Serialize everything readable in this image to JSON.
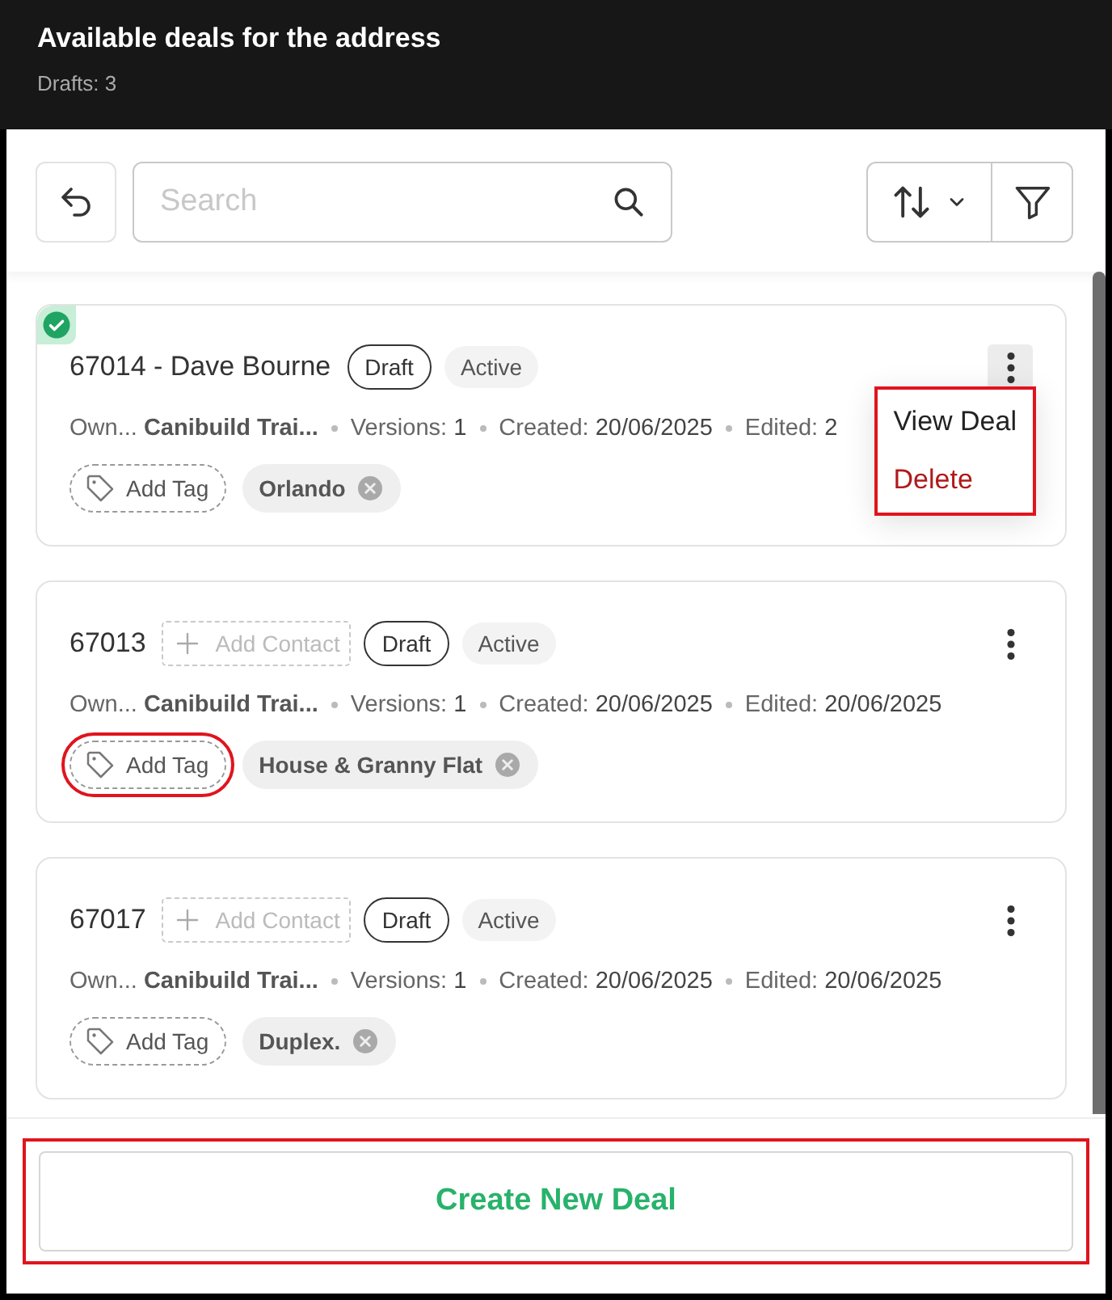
{
  "header": {
    "title": "Available deals for the address",
    "subtitle": "Drafts: 3"
  },
  "toolbar": {
    "search": {
      "placeholder": "Search"
    }
  },
  "deals": [
    {
      "title": "67014 - Dave Bourne",
      "selected": true,
      "badges": [
        {
          "label": "Draft",
          "kind": "outline"
        },
        {
          "label": "Active",
          "kind": "soft"
        }
      ],
      "meta": [
        {
          "label": "Own...",
          "value": "Canibuild Trai..."
        },
        {
          "label": "Versions:",
          "value": "1"
        },
        {
          "label": "Created:",
          "value": "20/06/2025"
        },
        {
          "label": "Edited:",
          "value": "2"
        }
      ],
      "add_tag": {
        "label": "Add Tag",
        "highlighted": false
      },
      "tags": [
        {
          "label": "Orlando"
        }
      ],
      "menu": {
        "open": true,
        "highlighted": true,
        "items": [
          {
            "label": "View Deal",
            "kind": "normal"
          },
          {
            "label": "Delete",
            "kind": "danger"
          }
        ]
      }
    },
    {
      "title": "67013",
      "add_contact": "Add Contact",
      "selected": false,
      "badges": [
        {
          "label": "Draft",
          "kind": "outline"
        },
        {
          "label": "Active",
          "kind": "soft"
        }
      ],
      "meta": [
        {
          "label": "Own...",
          "value": "Canibuild Trai..."
        },
        {
          "label": "Versions:",
          "value": "1"
        },
        {
          "label": "Created:",
          "value": "20/06/2025"
        },
        {
          "label": "Edited:",
          "value": "20/06/2025"
        }
      ],
      "add_tag": {
        "label": "Add Tag",
        "highlighted": true
      },
      "tags": [
        {
          "label": "House & Granny Flat"
        }
      ],
      "menu": {
        "open": false
      }
    },
    {
      "title": "67017",
      "add_contact": "Add Contact",
      "selected": false,
      "badges": [
        {
          "label": "Draft",
          "kind": "outline"
        },
        {
          "label": "Active",
          "kind": "soft"
        }
      ],
      "meta": [
        {
          "label": "Own...",
          "value": "Canibuild Trai..."
        },
        {
          "label": "Versions:",
          "value": "1"
        },
        {
          "label": "Created:",
          "value": "20/06/2025"
        },
        {
          "label": "Edited:",
          "value": "20/06/2025"
        }
      ],
      "add_tag": {
        "label": "Add Tag",
        "highlighted": false
      },
      "tags": [
        {
          "label": "Duplex."
        }
      ],
      "menu": {
        "open": false
      }
    }
  ],
  "footer": {
    "button": "Create New Deal",
    "highlighted": true
  }
}
